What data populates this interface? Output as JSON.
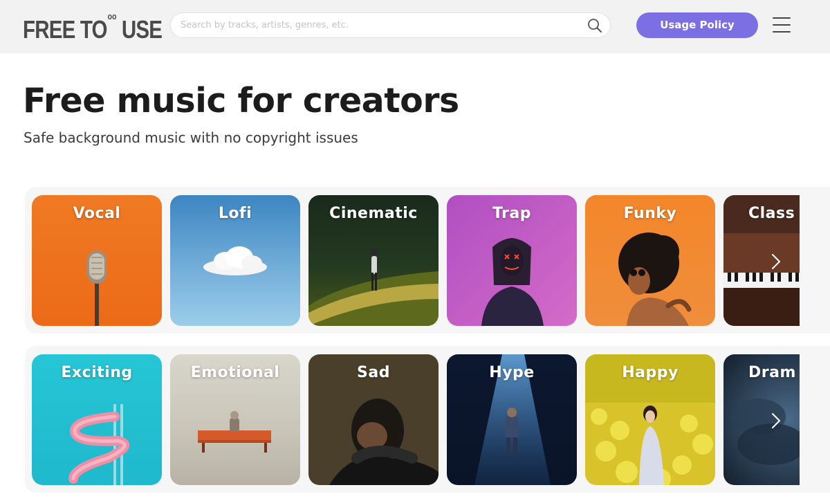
{
  "header": {
    "logo_main": "FREE TO",
    "logo_super": "oo",
    "logo_tail": "USE",
    "search_placeholder": "Search by tracks, artists, genres, etc.",
    "usage_button": "Usage Policy"
  },
  "hero": {
    "title": "Free music for creators",
    "subtitle": "Safe background music with no copyright issues"
  },
  "genres_row1": [
    "Vocal",
    "Lofi",
    "Cinematic",
    "Trap",
    "Funky",
    "Class"
  ],
  "genres_row2": [
    "Exciting",
    "Emotional",
    "Sad",
    "Hype",
    "Happy",
    "Dram"
  ],
  "icons": [
    "search-icon",
    "menu-icon",
    "chevron-right-icon"
  ],
  "colors": {
    "header_bg": "#f2f2f2",
    "accent": "#7b6fe3",
    "title": "#1c1c1c"
  }
}
